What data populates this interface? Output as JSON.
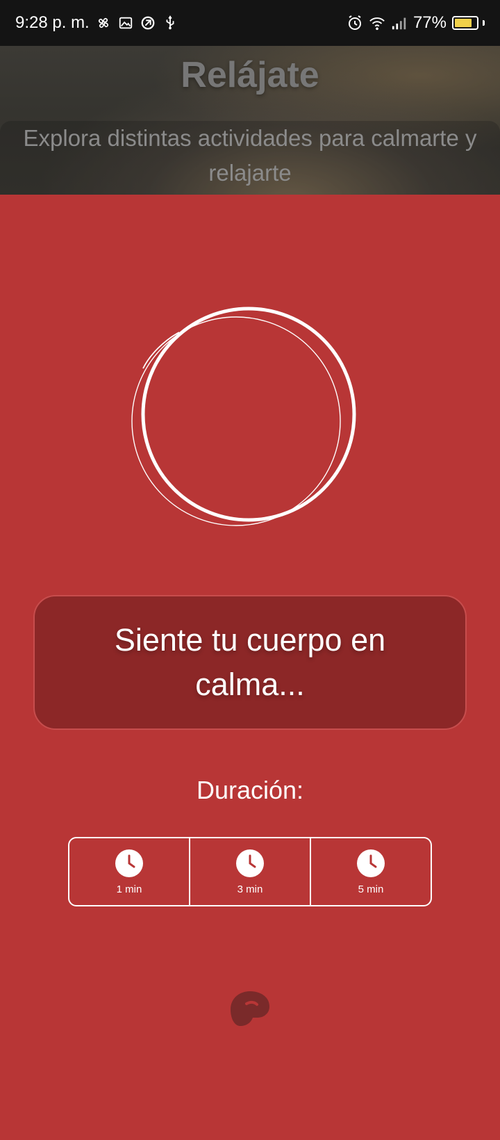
{
  "status_bar": {
    "time": "9:28 p. m.",
    "battery_percent_text": "77%",
    "battery_level": 0.77,
    "left_icons": [
      "fan-icon",
      "image-icon",
      "vpn-icon",
      "usb-icon"
    ],
    "right_icons": [
      "alarm-icon",
      "wifi-icon",
      "signal-icon",
      "battery-icon"
    ]
  },
  "header": {
    "title": "Relájate",
    "subtitle": "Explora distintas actividades para calmarte y relajarte"
  },
  "message": {
    "text": "Siente tu cuerpo en calma..."
  },
  "duration": {
    "label": "Duración:",
    "options": [
      {
        "label": "1 min",
        "icon": "clock-icon"
      },
      {
        "label": "3 min",
        "icon": "clock-icon"
      },
      {
        "label": "5 min",
        "icon": "clock-icon"
      }
    ]
  },
  "colors": {
    "background": "#b83636",
    "card": "#8c2727",
    "status_bar": "#141414",
    "battery_fill": "#f1d14a"
  },
  "footer": {
    "logo_icon": "brand-logo-icon"
  }
}
